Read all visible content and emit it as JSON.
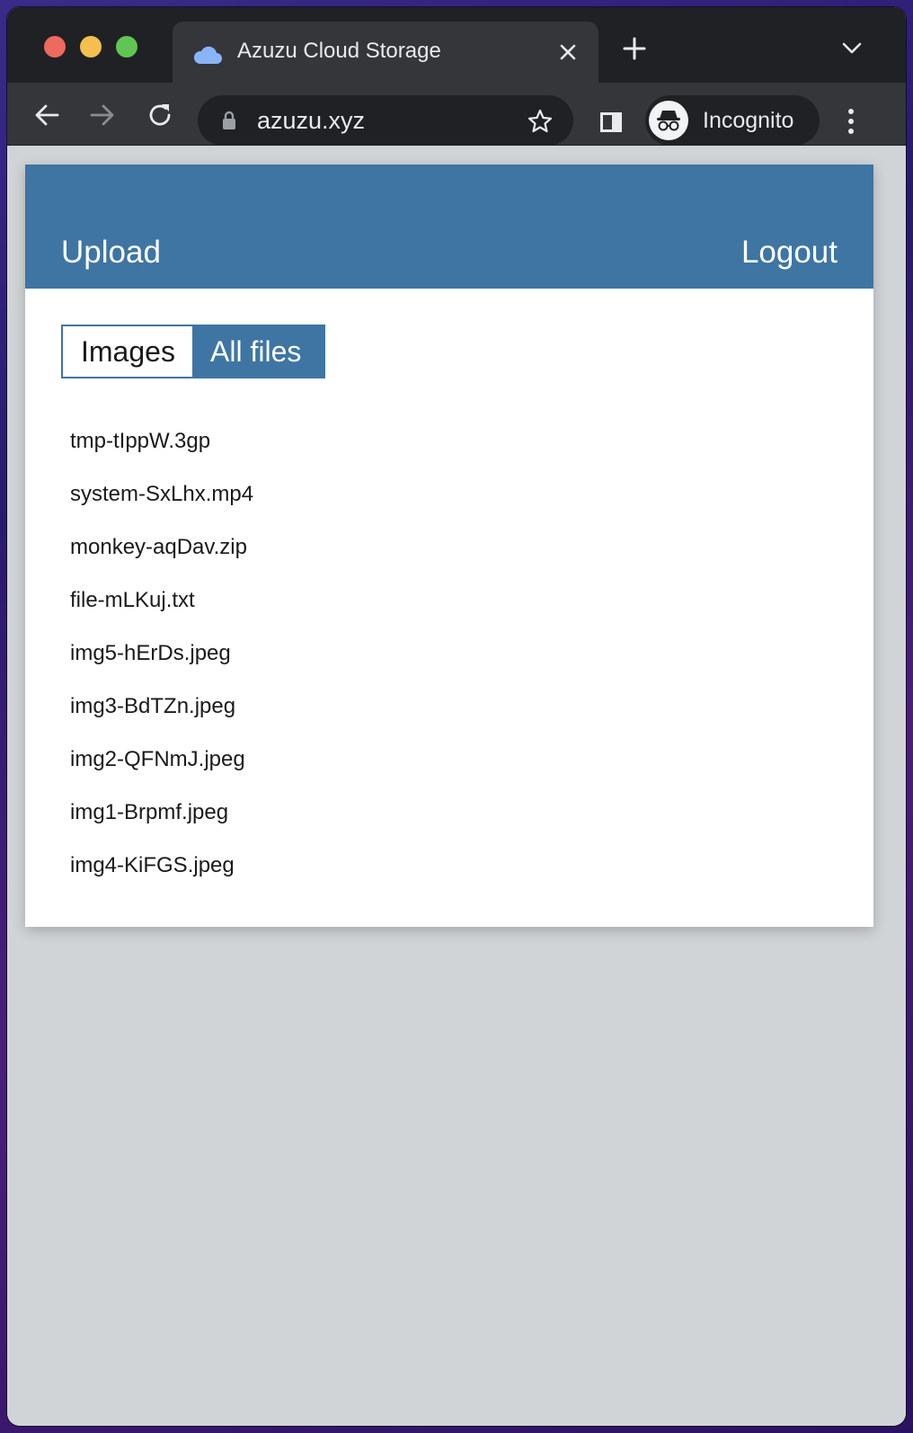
{
  "browser": {
    "tab_title": "Azuzu Cloud Storage",
    "url": "azuzu.xyz",
    "profile_label": "Incognito"
  },
  "header": {
    "upload_label": "Upload",
    "logout_label": "Logout",
    "color": "#3e75a3"
  },
  "filter": {
    "images_label": "Images",
    "all_files_label": "All files",
    "active": "All files"
  },
  "files": [
    "tmp-tIppW.3gp",
    "system-SxLhx.mp4",
    "monkey-aqDav.zip",
    "file-mLKuj.txt",
    "img5-hErDs.jpeg",
    "img3-BdTZn.jpeg",
    "img2-QFNmJ.jpeg",
    "img1-Brpmf.jpeg",
    "img4-KiFGS.jpeg"
  ]
}
